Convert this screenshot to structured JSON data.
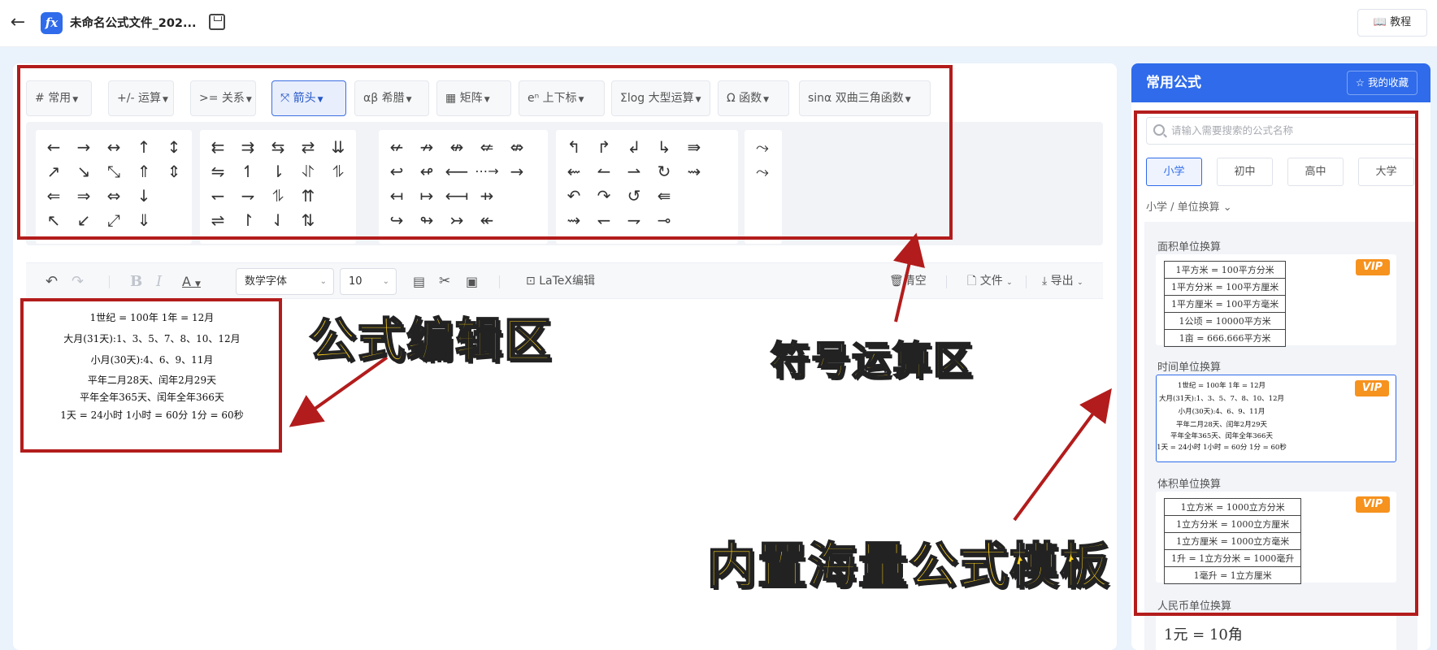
{
  "header": {
    "filename": "未命名公式文件_202...",
    "tutorial_label": "教程"
  },
  "symbol_tabs": [
    {
      "icon": "#",
      "label": "常用"
    },
    {
      "icon": "+/-",
      "label": "运算"
    },
    {
      "icon": ">=",
      "label": "关系"
    },
    {
      "icon": "⤧",
      "label": "箭头"
    },
    {
      "icon": "αβ",
      "label": "希腊"
    },
    {
      "icon": "▦",
      "label": "矩阵"
    },
    {
      "icon": "eⁿ",
      "label": "上下标"
    },
    {
      "icon": "Σlog",
      "label": "大型运算"
    },
    {
      "icon": "Ω",
      "label": "函数"
    },
    {
      "icon": "sinα",
      "label": "双曲三角函数"
    }
  ],
  "arrow_groups": [
    [
      "←",
      "→",
      "↔",
      "↑",
      "↕",
      "↗",
      "↘",
      "⤡",
      "⇑",
      "⇕",
      "⇐",
      "⇒",
      "⇔",
      "↓",
      "",
      "↖",
      "↙",
      "⤢",
      "⇓",
      ""
    ],
    [
      "⇇",
      "⇉",
      "⇆",
      "⇄",
      "⇊",
      "⇋",
      "↿",
      "⇂",
      "⥯",
      "⥮",
      "↽",
      "⇁",
      "⥮",
      "⇈",
      "",
      "⇌",
      "↾",
      "⇃",
      "⇅",
      ""
    ],
    [
      "↚",
      "↛",
      "↮",
      "⇍",
      "⇎",
      "↩",
      "↫",
      "⟵",
      "⋯→",
      "→",
      "↤",
      "↦",
      "⟻",
      "⇸",
      "",
      "↪",
      "↬",
      "↣",
      "↞",
      ""
    ],
    [
      "↰",
      "↱",
      "↲",
      "↳",
      "⇛",
      "⇜",
      "↼",
      "⇀",
      "↻",
      "⇝",
      "↶",
      "↷",
      "↺",
      "⇚",
      "",
      "⇝",
      "↽",
      "⇁",
      "⊸",
      ""
    ],
    [
      "⤳",
      "⤳"
    ]
  ],
  "editor_toolbar": {
    "font": "数学字体",
    "size": "10",
    "latex": "LaTeX编辑",
    "clear": "清空",
    "file": "文件",
    "export": "导出"
  },
  "formula_lines": [
    "1世纪 = 100年   1年 = 12月",
    "大月(31天):1、3、5、7、8、10、12月",
    "小月(30天):4、6、9、11月",
    "平年二月28天、闰年2月29天",
    "平年全年365天、闰年全年366天",
    "1天 = 24小时  1小时 = 60分  1分 = 60秒"
  ],
  "annotations": {
    "editor": "公式编辑区",
    "symbols": "符号运算区",
    "templates": "内置海量公式模板"
  },
  "sidebar": {
    "title": "常用公式",
    "favorites": "我的收藏",
    "search_placeholder": "请输入需要搜索的公式名称",
    "levels": [
      "小学",
      "初中",
      "高中",
      "大学"
    ],
    "breadcrumb": "小学 / 单位换算",
    "sections": [
      {
        "title": "面积单位换算",
        "vip": "VIP",
        "rows": [
          "1平方米 = 100平方分米",
          "1平方分米 = 100平方厘米",
          "1平方厘米 = 100平方毫米",
          "1公顷 = 10000平方米",
          "1亩 = 666.666平方米"
        ]
      },
      {
        "title": "时间单位换算",
        "vip": "VIP",
        "rows": []
      },
      {
        "title": "体积单位换算",
        "vip": "VIP",
        "rows": [
          "1立方米 = 1000立方分米",
          "1立方分米 = 1000立方厘米",
          "1立方厘米 = 1000立方毫米",
          "1升 = 1立方分米 = 1000毫升",
          "1毫升 = 1立方厘米"
        ]
      },
      {
        "title": "人民币单位换算",
        "vip": "",
        "rows": [
          "1元 = 10角"
        ]
      }
    ]
  }
}
